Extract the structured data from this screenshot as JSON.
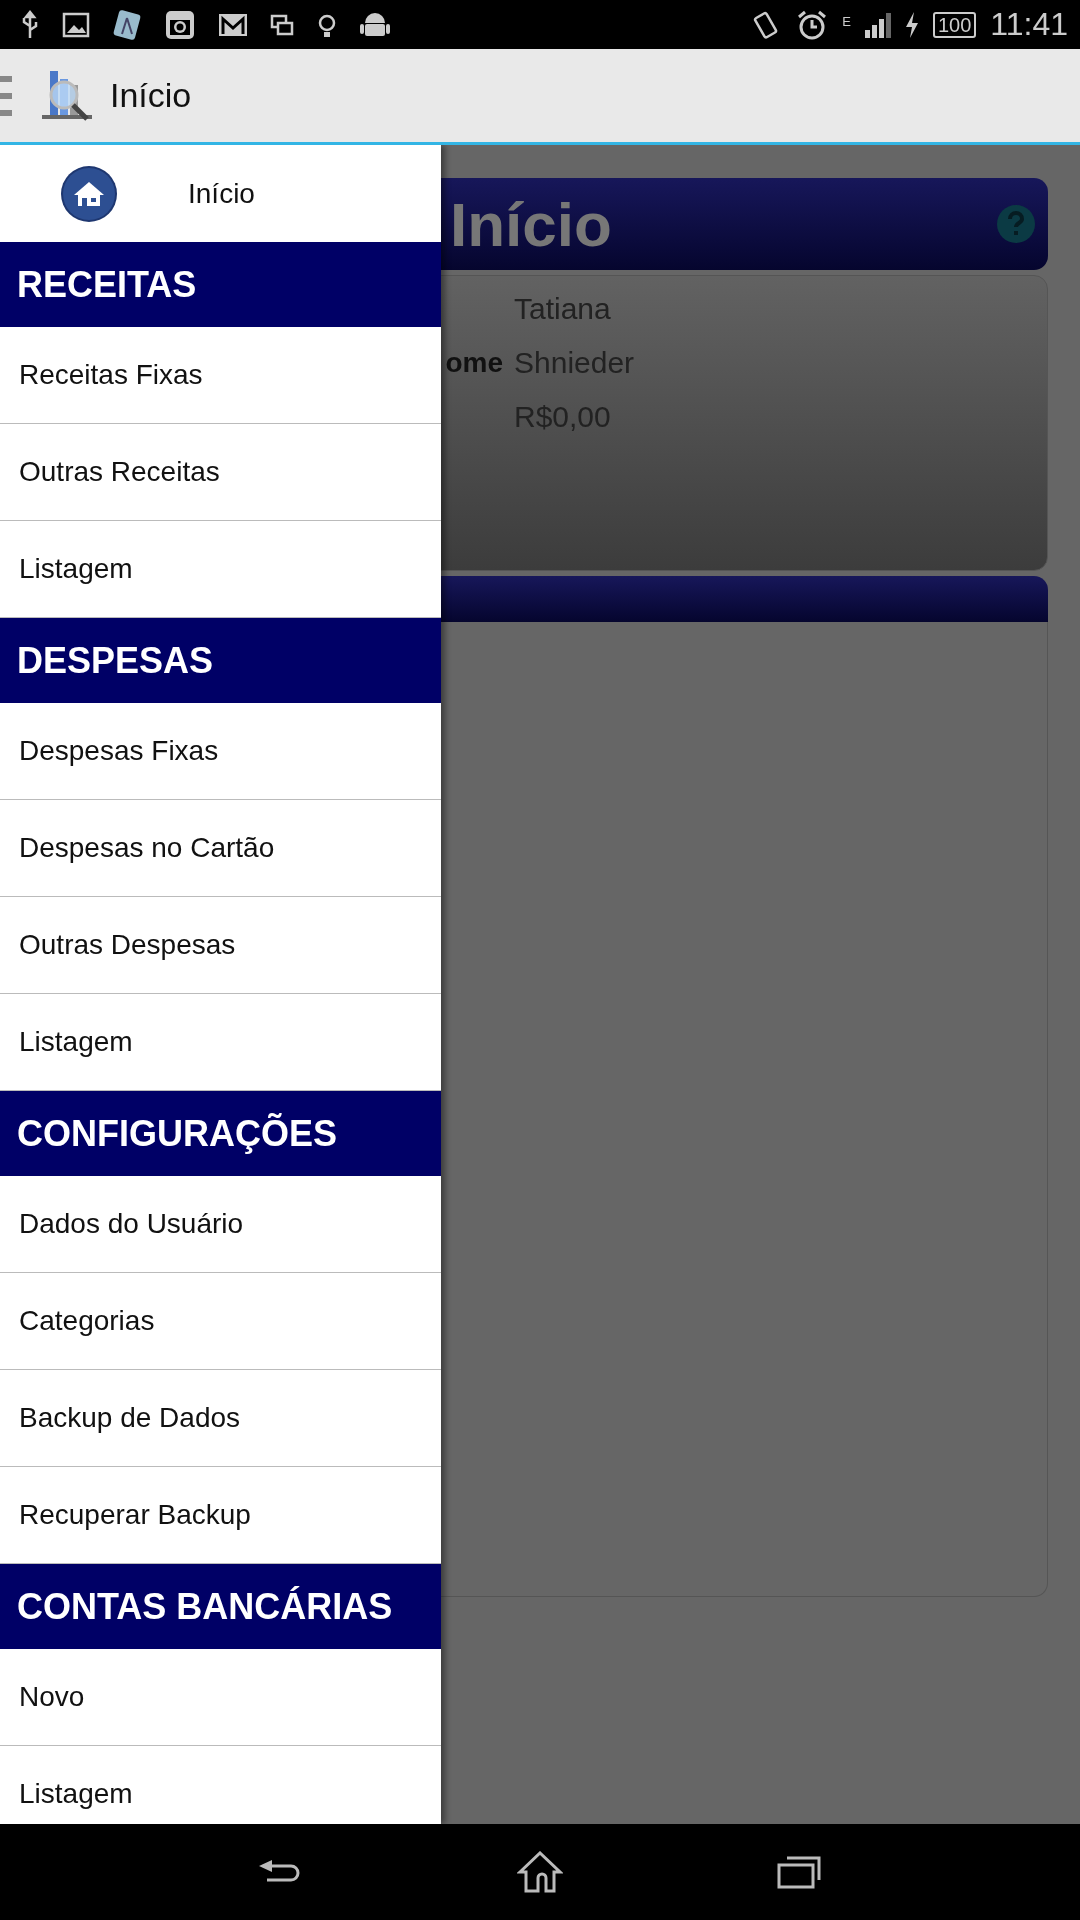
{
  "status_bar": {
    "network": "E",
    "battery": "100",
    "time": "11:41"
  },
  "app_bar": {
    "title": "Início"
  },
  "background": {
    "card_title": "Início",
    "rows": [
      {
        "label": "",
        "value": "Tatiana"
      },
      {
        "label": "ome",
        "value": "Shnieder"
      },
      {
        "label": "",
        "value": "R$0,00"
      }
    ]
  },
  "drawer": {
    "home": {
      "label": "Início"
    },
    "sections": [
      {
        "title": "RECEITAS",
        "items": [
          "Receitas Fixas",
          "Outras Receitas",
          "Listagem"
        ]
      },
      {
        "title": "DESPESAS",
        "items": [
          "Despesas Fixas",
          "Despesas no Cartão",
          "Outras Despesas",
          "Listagem"
        ]
      },
      {
        "title": "CONFIGURAÇÕES",
        "items": [
          "Dados do Usuário",
          "Categorias",
          "Backup de Dados",
          "Recuperar Backup"
        ]
      },
      {
        "title": "CONTAS BANCÁRIAS",
        "items": [
          "Novo",
          "Listagem"
        ]
      }
    ]
  }
}
